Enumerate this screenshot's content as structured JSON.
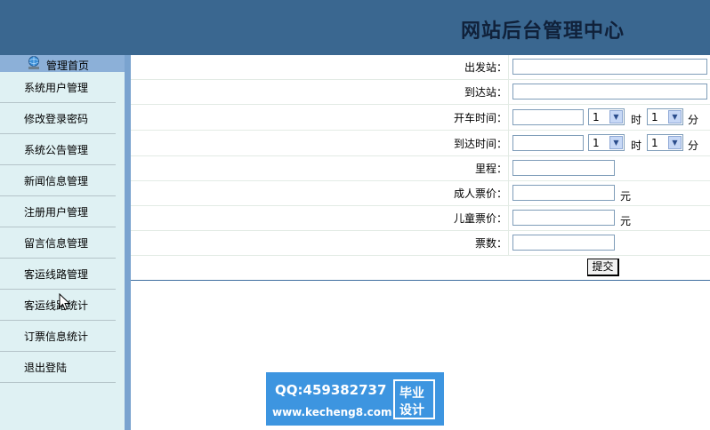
{
  "header": {
    "title": "网站后台管理中心"
  },
  "sidebar": {
    "home_label": "管理首页",
    "items": [
      {
        "label": "系统用户管理"
      },
      {
        "label": "修改登录密码"
      },
      {
        "label": "系统公告管理"
      },
      {
        "label": "新闻信息管理"
      },
      {
        "label": "注册用户管理"
      },
      {
        "label": "留言信息管理"
      },
      {
        "label": "客运线路管理"
      },
      {
        "label": "客运线路统计"
      },
      {
        "label": "订票信息统计"
      },
      {
        "label": "退出登陆"
      }
    ]
  },
  "form": {
    "departure_label": "出发站：",
    "arrival_label": "到达站：",
    "depart_time_label": "开车时间：",
    "arrive_time_label": "到达时间：",
    "mileage_label": "里程：",
    "adult_price_label": "成人票价：",
    "child_price_label": "儿童票价：",
    "tickets_label": "票数：",
    "hour_unit": "时",
    "minute_unit": "分",
    "price_unit": "元",
    "depart_hour": "1",
    "depart_minute": "1",
    "arrive_hour": "1",
    "arrive_minute": "1",
    "submit_label": "提交"
  },
  "watermark": {
    "qq": "QQ:459382737",
    "url": "www.kecheng8.com",
    "badge_line1": "毕业",
    "badge_line2": "设计"
  },
  "colors": {
    "header_bg": "#3a6790",
    "sidebar_bg": "#dff1f3",
    "accent": "#7aa3cf",
    "watermark_bg": "#3d95e0"
  }
}
